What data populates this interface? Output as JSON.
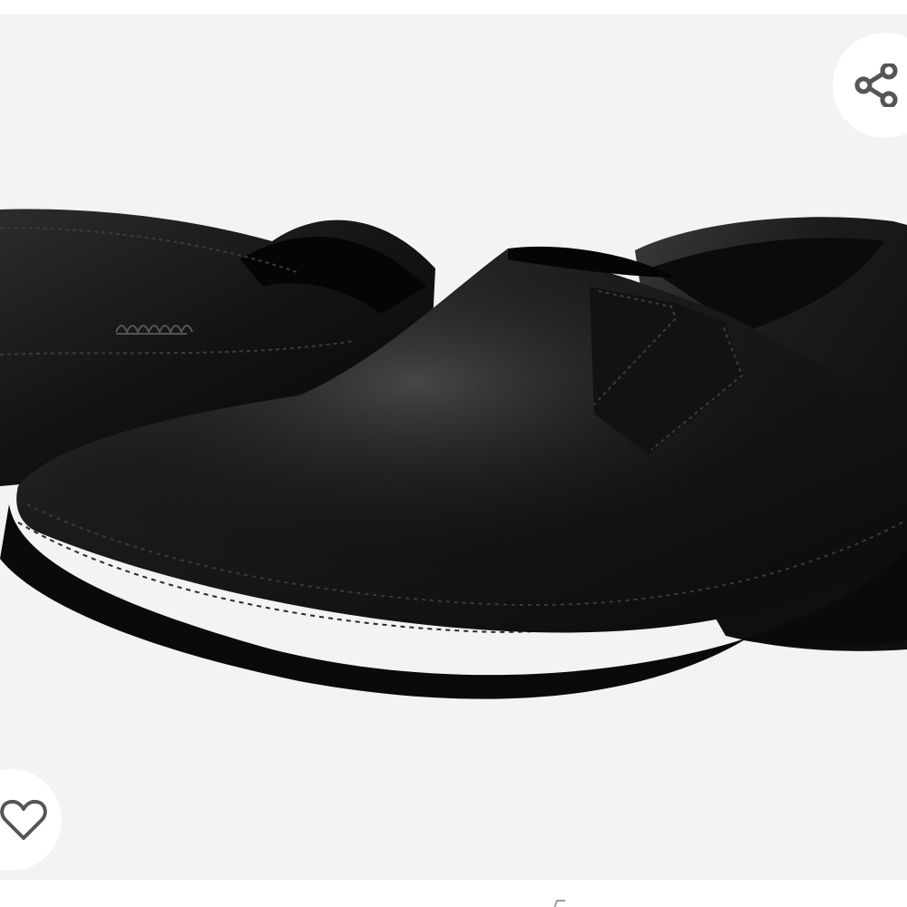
{
  "viewer": {
    "background": "#f3f3f3",
    "image_subject": "product-image"
  },
  "actions": {
    "share_icon": "share-icon",
    "wishlist_icon": "heart-outline-icon"
  },
  "colors": {
    "icon": "#555555",
    "button_bg": "#ffffff"
  }
}
